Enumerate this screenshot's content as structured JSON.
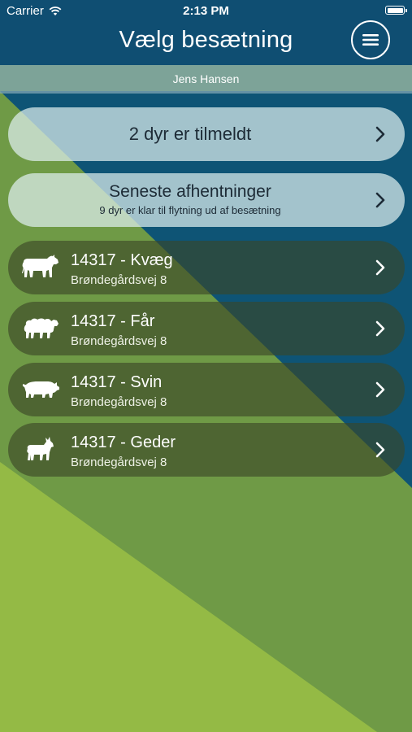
{
  "status_bar": {
    "carrier": "Carrier",
    "time": "2:13 PM"
  },
  "nav": {
    "title": "Vælg besætning"
  },
  "user_bar": {
    "name": "Jens Hansen"
  },
  "registered": {
    "label": "2 dyr er tilmeldt"
  },
  "pickups": {
    "title": "Seneste afhentninger",
    "subtitle": "9 dyr er klar til flytning ud af besætning"
  },
  "herds": [
    {
      "title": "14317 - Kvæg",
      "address": "Brøndegårdsvej 8",
      "icon": "cow-icon"
    },
    {
      "title": "14317 - Får",
      "address": "Brøndegårdsvej 8",
      "icon": "sheep-icon"
    },
    {
      "title": "14317 - Svin",
      "address": "Brøndegårdsvej 8",
      "icon": "pig-icon"
    },
    {
      "title": "14317 - Geder",
      "address": "Brøndegårdsvej 8",
      "icon": "goat-icon"
    }
  ],
  "colors": {
    "navy": "#0f4e72",
    "blue_wedge": "#0e5475",
    "green_light": "#94ba45",
    "green_dark": "#6f9a46",
    "pill_light": "#deeeee",
    "pill_dark": "#3a4626"
  }
}
